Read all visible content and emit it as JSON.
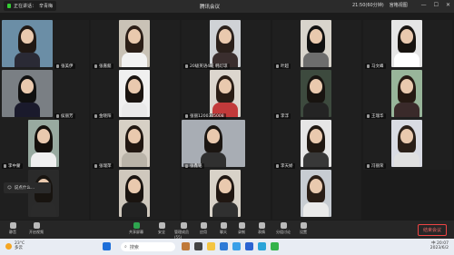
{
  "titlebar": {
    "speaker_prefix": "正在讲话：",
    "speaker_name": "辛青梅",
    "title": "腾讯会议",
    "meeting_id": "21:50(60分钟)",
    "view_mode": "宫格视图",
    "minimize": "—",
    "maximize": "☐",
    "close": "✕"
  },
  "participants": [
    {
      "name": "张美伊",
      "bg": "#6b8ea6",
      "hair": "#201813",
      "shirt": "#2a2a35"
    },
    {
      "name": "张嘉懿",
      "bg": "#c9c2b6",
      "hair": "#2b1e17",
      "shirt": "#f2f2f2"
    },
    {
      "name": "20级英语4班 韩灯琼",
      "bg": "#cfd2d6",
      "hair": "#2a201b",
      "shirt": "#3a2e2e"
    },
    {
      "name": "叶超",
      "bg": "#d8d4cc",
      "hair": "#111",
      "shirt": "#6d6d6d"
    },
    {
      "name": "马文峰",
      "bg": "#e5e5e5",
      "hair": "#181410",
      "shirt": "#fff"
    },
    {
      "name": "侯丽芳",
      "bg": "#7a7f84",
      "hair": "#101010",
      "shirt": "#1a1a2c"
    },
    {
      "name": "金晓阳",
      "bg": "#f0f0f0",
      "hair": "#1a1410",
      "shirt": "#e9e9e9"
    },
    {
      "name": "张丽1200305008",
      "bg": "#dcd6ce",
      "hair": "#2a1d15",
      "shirt": "#c23a3a"
    },
    {
      "name": "李浮",
      "bg": "#3d4a3e",
      "hair": "#181410",
      "shirt": "#242424"
    },
    {
      "name": "王瑞华",
      "bg": "#98b59a",
      "hair": "#251912",
      "shirt": "#3a2a2a"
    },
    {
      "name": "李中蒙",
      "bg": "#98aaa0",
      "hair": "#14100c",
      "shirt": "#efefef"
    },
    {
      "name": "张瑞萍",
      "bg": "#d7d0c5",
      "hair": "#211711",
      "shirt": "#b9b3a8"
    },
    {
      "name": "张鑫铭",
      "bg": "#a8adb4",
      "hair": "#1b1612",
      "shirt": "#303030"
    },
    {
      "name": "李天娇",
      "bg": "#e6e6e6",
      "hair": "#201812",
      "shirt": "#383838"
    },
    {
      "name": "冯丽荣",
      "bg": "#d9dbe3",
      "hair": "#2a1f18",
      "shirt": "#e0e0e0"
    },
    {
      "name": "",
      "bg": "#2a2a2a",
      "hair": "#181410",
      "shirt": "#2b2b2b"
    },
    {
      "name": "",
      "bg": "#cfc8bd",
      "hair": "#1a1410",
      "shirt": "#222"
    },
    {
      "name": "",
      "bg": "#d8d2c8",
      "hair": "#201712",
      "shirt": "#303030"
    },
    {
      "name": "",
      "bg": "#c7ccd2",
      "hair": "#2a1e16",
      "shirt": "#eaeaea"
    }
  ],
  "chat": {
    "placeholder": "说点什么…"
  },
  "toolbar": {
    "items": [
      "静音",
      "开启视频",
      "共享屏幕",
      "安全",
      "管理成员(55)",
      "应用",
      "聊天",
      "录制",
      "表情",
      "分组讨论",
      "设置"
    ],
    "end_label": "结束会议"
  },
  "taskbar": {
    "temperature": "23°C",
    "weather": "多云",
    "search": "搜索",
    "lang": "中",
    "time": "20:07",
    "date": "2023/6/2"
  },
  "colors": {
    "accent": "#2ea44f",
    "end": "#e44444"
  }
}
